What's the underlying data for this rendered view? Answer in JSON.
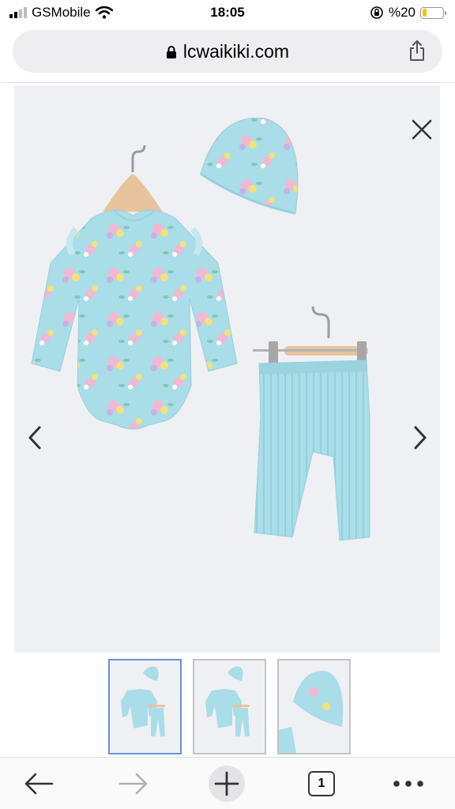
{
  "status_bar": {
    "carrier": "GSMobile",
    "time": "18:05",
    "battery_text": "%20",
    "battery_level": 0.2,
    "icons": [
      "signal-icon",
      "wifi-icon",
      "orientation-lock-icon",
      "battery-icon"
    ]
  },
  "browser": {
    "url": "lcwaikiki.com",
    "icons": [
      "lock-icon",
      "share-icon"
    ]
  },
  "gallery": {
    "controls": [
      "close-icon",
      "chevron-left-icon",
      "chevron-right-icon"
    ],
    "colors": {
      "background": "#eff0f3",
      "garment": "#a9dde8",
      "hanger": "#e7c49d"
    }
  },
  "thumbnails": {
    "count": 3,
    "active_index": 0
  },
  "toolbar": {
    "tab_count": "1",
    "icons": [
      "back-arrow-icon",
      "forward-arrow-icon",
      "plus-icon",
      "tabs-icon",
      "more-icon"
    ]
  }
}
